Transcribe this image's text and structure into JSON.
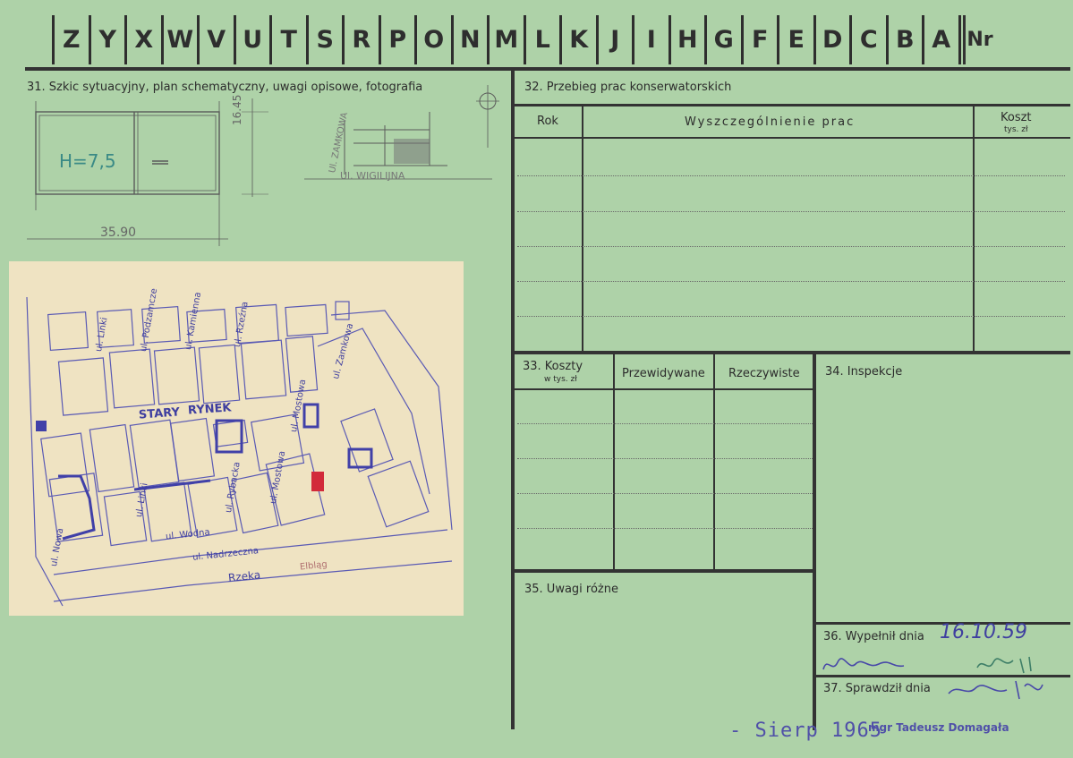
{
  "header": {
    "letters": [
      "Z",
      "Y",
      "X",
      "W",
      "V",
      "U",
      "T",
      "S",
      "R",
      "P",
      "O",
      "N",
      "M",
      "L",
      "K",
      "J",
      "I",
      "H",
      "G",
      "F",
      "E",
      "D",
      "C",
      "B",
      "A",
      "Nr"
    ]
  },
  "section31": {
    "label": "31. Szkic sytuacyjny, plan schematyczny, uwagi opisowe, fotografia",
    "sketch": {
      "height_note": "H=7,5",
      "dim_width": "35.90",
      "dim_depth": "16.45",
      "street_a": "Ul. ZAMKOWA",
      "street_b": "Ul. WIGILIJNA"
    }
  },
  "map": {
    "square": "STARY",
    "square2": "RYNEK",
    "streets": [
      "ul. Linki",
      "ul. Podzamcze",
      "ul. Kamienna",
      "ul. Rzeźna",
      "ul. Mostowa",
      "ul. Rybacka",
      "ul. Mostowa",
      "ul. Wodna",
      "ul. Nadrzeczna",
      "ul. Nowa",
      "ul. Linki",
      "ul. Zamkowa"
    ],
    "river": "Rzeka",
    "river_name": "Elbląg"
  },
  "section32": {
    "label": "32. Przebieg prac konserwatorskich",
    "col_rok": "Rok",
    "col_work": "Wyszczególnienie prac",
    "col_cost": "Koszt",
    "col_cost_unit": "tys. zł"
  },
  "section33": {
    "label": "33. Koszty",
    "label_unit": "w tys. zł",
    "col_planned": "Przewidywane",
    "col_actual": "Rzeczywiste"
  },
  "section34": {
    "label": "34. Inspekcje"
  },
  "section35": {
    "label": "35. Uwagi różne"
  },
  "section36": {
    "label": "36. Wypełnił dnia",
    "date": "16.10.59"
  },
  "section37": {
    "label": "37. Sprawdził dnia"
  },
  "stamps": {
    "date_stamp": "- Sierp 1965",
    "name_stamp": "mgr Tadeusz Domagała"
  },
  "colors": {
    "card": "#aed2a8",
    "ink": "#333333",
    "handwriting": "#3f3fa0",
    "photo": "#efe3c2"
  }
}
